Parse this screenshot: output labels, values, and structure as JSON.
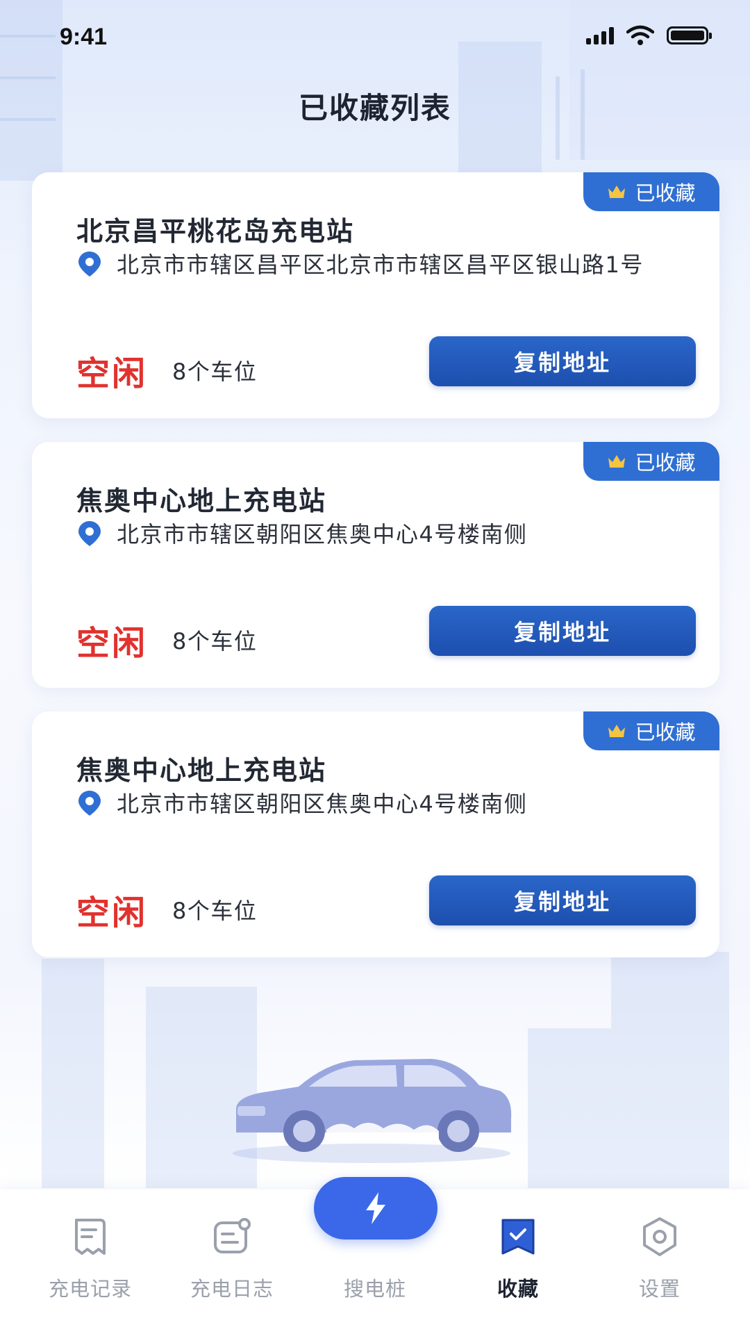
{
  "status_bar": {
    "time": "9:41"
  },
  "page": {
    "title": "已收藏列表"
  },
  "cards": [
    {
      "badge": "已收藏",
      "name": "北京昌平桃花岛充电站",
      "address": "北京市市辖区昌平区北京市市辖区昌平区银山路1号",
      "status": "空闲",
      "spots": "8个车位",
      "button": "复制地址"
    },
    {
      "badge": "已收藏",
      "name": "焦奥中心地上充电站",
      "address": "北京市市辖区朝阳区焦奥中心4号楼南侧",
      "status": "空闲",
      "spots": "8个车位",
      "button": "复制地址"
    },
    {
      "badge": "已收藏",
      "name": "焦奥中心地上充电站",
      "address": "北京市市辖区朝阳区焦奥中心4号楼南侧",
      "status": "空闲",
      "spots": "8个车位",
      "button": "复制地址"
    }
  ],
  "nav": {
    "items": [
      {
        "label": "充电记录",
        "icon": "receipt-icon"
      },
      {
        "label": "充电日志",
        "icon": "log-icon"
      },
      {
        "label": "搜电桩",
        "icon": "lightning-icon"
      },
      {
        "label": "收藏",
        "icon": "bookmark-icon",
        "active": true
      },
      {
        "label": "设置",
        "icon": "settings-icon"
      }
    ]
  },
  "colors": {
    "primary": "#2f6fd3",
    "button": "#1d4fae",
    "status_free": "#e0322e",
    "nav_center": "#3a68e8"
  }
}
